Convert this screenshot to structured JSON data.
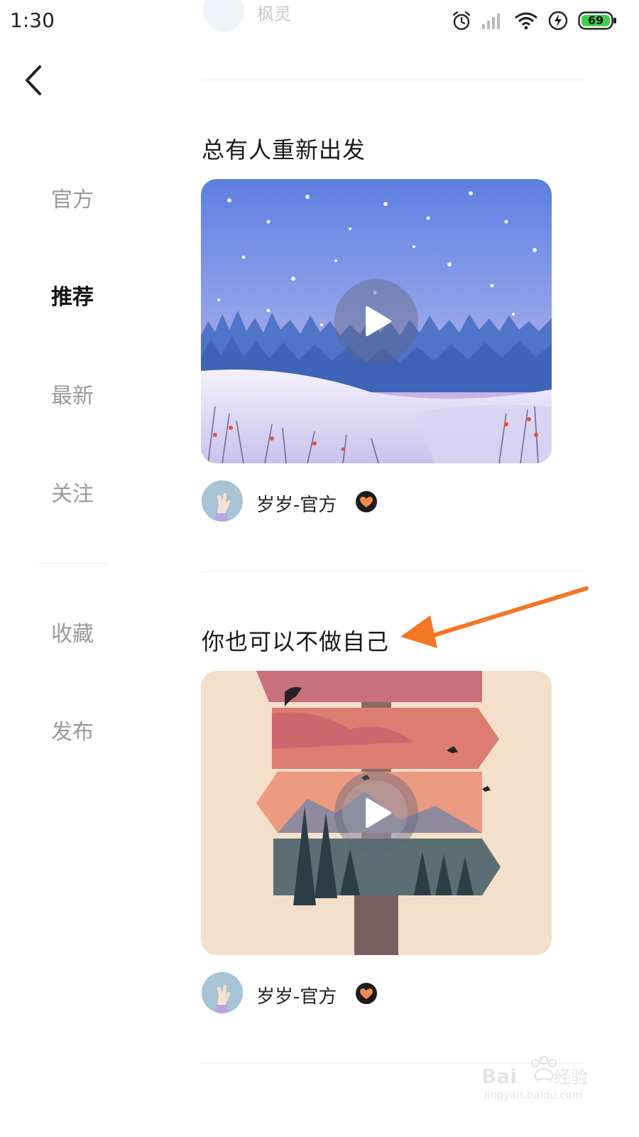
{
  "status_bar": {
    "time": "1:30",
    "battery_level": "69",
    "icons": [
      "alarm-icon",
      "signal-icon",
      "wifi-icon",
      "charging-icon",
      "battery-icon"
    ]
  },
  "previous_post": {
    "author_name": "枫灵"
  },
  "sidebar": {
    "items": [
      {
        "label": "官方",
        "active": false
      },
      {
        "label": "推荐",
        "active": true
      },
      {
        "label": "最新",
        "active": false
      },
      {
        "label": "关注",
        "active": false
      },
      {
        "label": "收藏",
        "active": false
      },
      {
        "label": "发布",
        "active": false
      }
    ]
  },
  "posts": [
    {
      "title": "总有人重新出发",
      "author_name": "岁岁-官方",
      "verified": true
    },
    {
      "title": "你也可以不做自己",
      "author_name": "岁岁-官方",
      "verified": true
    }
  ],
  "colors": {
    "annotation_arrow": "#f47524",
    "badge": "#1c1c1c",
    "badge_heart": "#f08a4b"
  },
  "watermark": {
    "text": "Baidu经验",
    "url_text": "jingyan.baidu.com"
  }
}
